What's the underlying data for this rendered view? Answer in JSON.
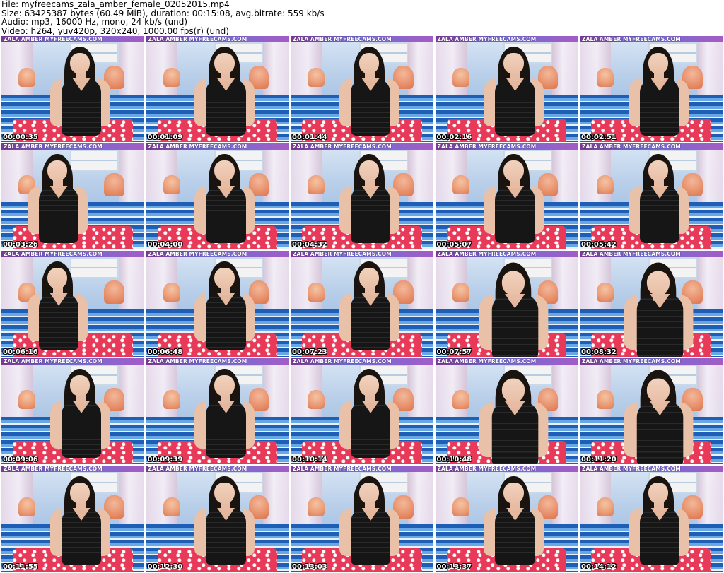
{
  "meta": {
    "file_line": "File: myfreecams_zala_amber_female_02052015.mp4",
    "size_line": "Size: 63425387 bytes (60.49 MiB), duration: 00:15:08, avg.bitrate: 559 kb/s",
    "audio_line": "Audio: mp3, 16000 Hz, mono, 24 kb/s (und)",
    "video_line": "Video: h264, yuv420p, 320x240, 1000.00 fps(r) (und)"
  },
  "banner_text": "ZALA AMBER MYFREECAMS.COM",
  "thumbnails": [
    {
      "time": "00:00:35",
      "pose": "center"
    },
    {
      "time": "00:01:09",
      "pose": "center"
    },
    {
      "time": "00:01:44",
      "pose": "center"
    },
    {
      "time": "00:02:16",
      "pose": "center"
    },
    {
      "time": "00:02:51",
      "pose": "center"
    },
    {
      "time": "00:03:26",
      "pose": "left"
    },
    {
      "time": "00:04:00",
      "pose": "center"
    },
    {
      "time": "00:04:32",
      "pose": "center"
    },
    {
      "time": "00:05:07",
      "pose": "center"
    },
    {
      "time": "00:05:42",
      "pose": "center"
    },
    {
      "time": "00:06:16",
      "pose": "left"
    },
    {
      "time": "00:06:48",
      "pose": "center"
    },
    {
      "time": "00:07:23",
      "pose": "center"
    },
    {
      "time": "00:07:57",
      "pose": "close"
    },
    {
      "time": "00:08:32",
      "pose": "close"
    },
    {
      "time": "00:09:06",
      "pose": "center"
    },
    {
      "time": "00:09:39",
      "pose": "center"
    },
    {
      "time": "00:10:14",
      "pose": "center"
    },
    {
      "time": "00:10:48",
      "pose": "close"
    },
    {
      "time": "00:11:20",
      "pose": "close"
    },
    {
      "time": "00:11:55",
      "pose": "center"
    },
    {
      "time": "00:12:30",
      "pose": "center"
    },
    {
      "time": "00:13:03",
      "pose": "center"
    },
    {
      "time": "00:13:37",
      "pose": "center"
    },
    {
      "time": "00:14:12",
      "pose": "center"
    }
  ]
}
